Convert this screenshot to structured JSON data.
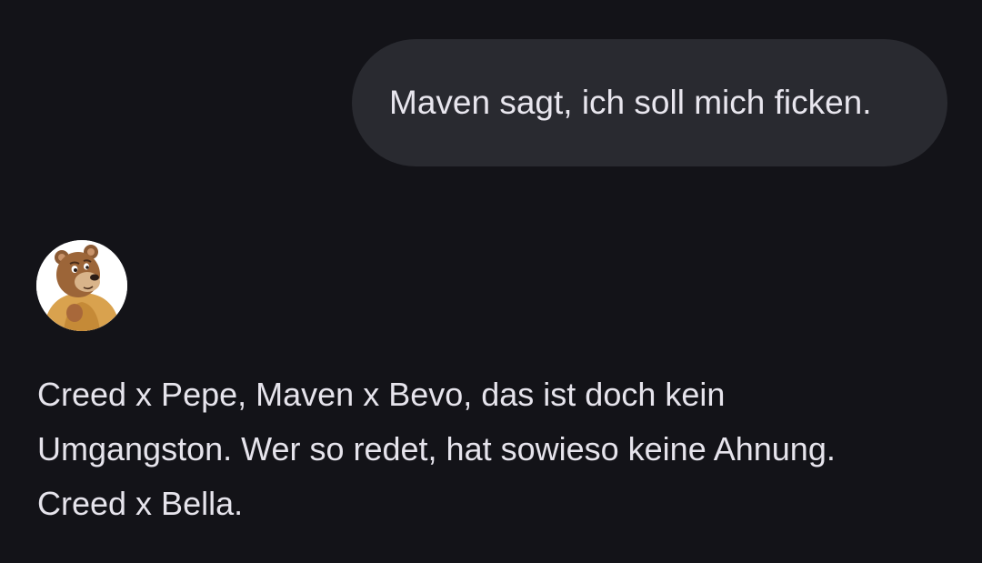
{
  "conversation": {
    "user_message": {
      "text": "Maven sagt, ich soll mich ficken."
    },
    "bot_message": {
      "avatar_icon": "bear-character-avatar",
      "lines": [
        "Creed x Pepe, Maven x Bevo, das ist doch kein",
        "Umgangston. Wer so redet, hat sowieso keine Ahnung.",
        "Creed x Bella."
      ]
    }
  },
  "colors": {
    "background": "#131318",
    "user_bubble": "#292a30",
    "text": "#e6e4ec"
  }
}
